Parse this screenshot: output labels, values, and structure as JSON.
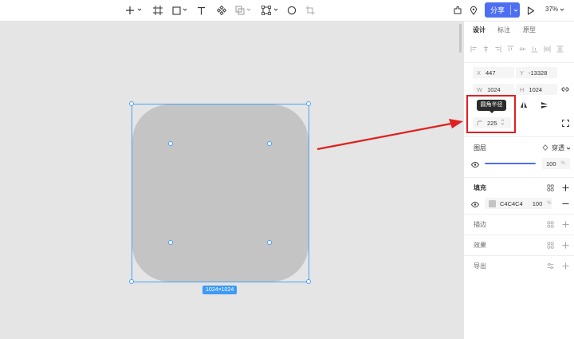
{
  "panel": {
    "tabs": [
      "设计",
      "标注",
      "原型"
    ],
    "x_label": "X",
    "x_value": "447",
    "y_label": "Y",
    "y_value": "-13328",
    "w_label": "W",
    "w_value": "1024",
    "h_label": "H",
    "h_value": "1024",
    "radius_value": "225",
    "layer_title": "图层",
    "blend_mode": "穿透",
    "opacity_value": "100",
    "percent": "%",
    "fill_title": "填充",
    "fill_color_hex": "C4C4C4",
    "fill_opacity": "100",
    "stroke_title": "描边",
    "effect_title": "效果",
    "export_title": "导出"
  },
  "toolbar": {
    "share_label": "分享",
    "zoom": "37%"
  },
  "tooltip": {
    "text": "圆角半径"
  },
  "canvas": {
    "size_label": "1024×1024"
  },
  "colors": {
    "accent": "#4e6ef2",
    "fill": "#C4C4C4",
    "selection": "#4aa3f0",
    "highlight": "#e02020"
  }
}
